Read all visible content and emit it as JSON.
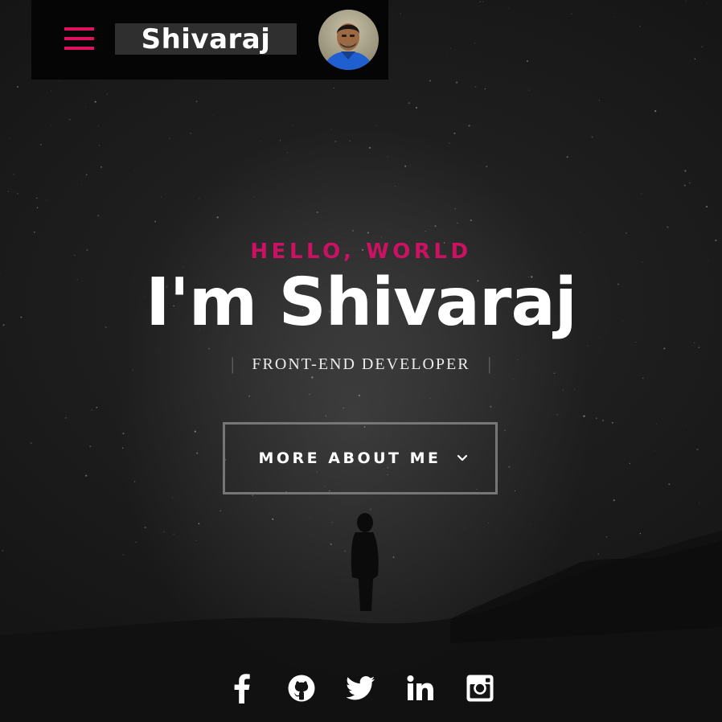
{
  "header": {
    "brand_name": "Shivaraj",
    "menu_icon": "hamburger-menu-icon",
    "avatar": "profile-photo"
  },
  "hero": {
    "eyebrow": "HELLO, WORLD",
    "headline": "I'm Shivaraj",
    "role": "FRONT-END DEVELOPER",
    "cta_label": "MORE ABOUT ME",
    "cta_icon": "chevron-down-icon"
  },
  "social_links": [
    {
      "name": "facebook",
      "icon": "facebook-icon"
    },
    {
      "name": "github",
      "icon": "github-icon"
    },
    {
      "name": "twitter",
      "icon": "twitter-icon"
    },
    {
      "name": "linkedin",
      "icon": "linkedin-icon"
    },
    {
      "name": "instagram",
      "icon": "instagram-icon"
    }
  ],
  "colors": {
    "accent": "#cc1163",
    "menu": "#e0115f",
    "background": "#1e1e1e",
    "text": "#ffffff",
    "cta_border": "#767676"
  }
}
